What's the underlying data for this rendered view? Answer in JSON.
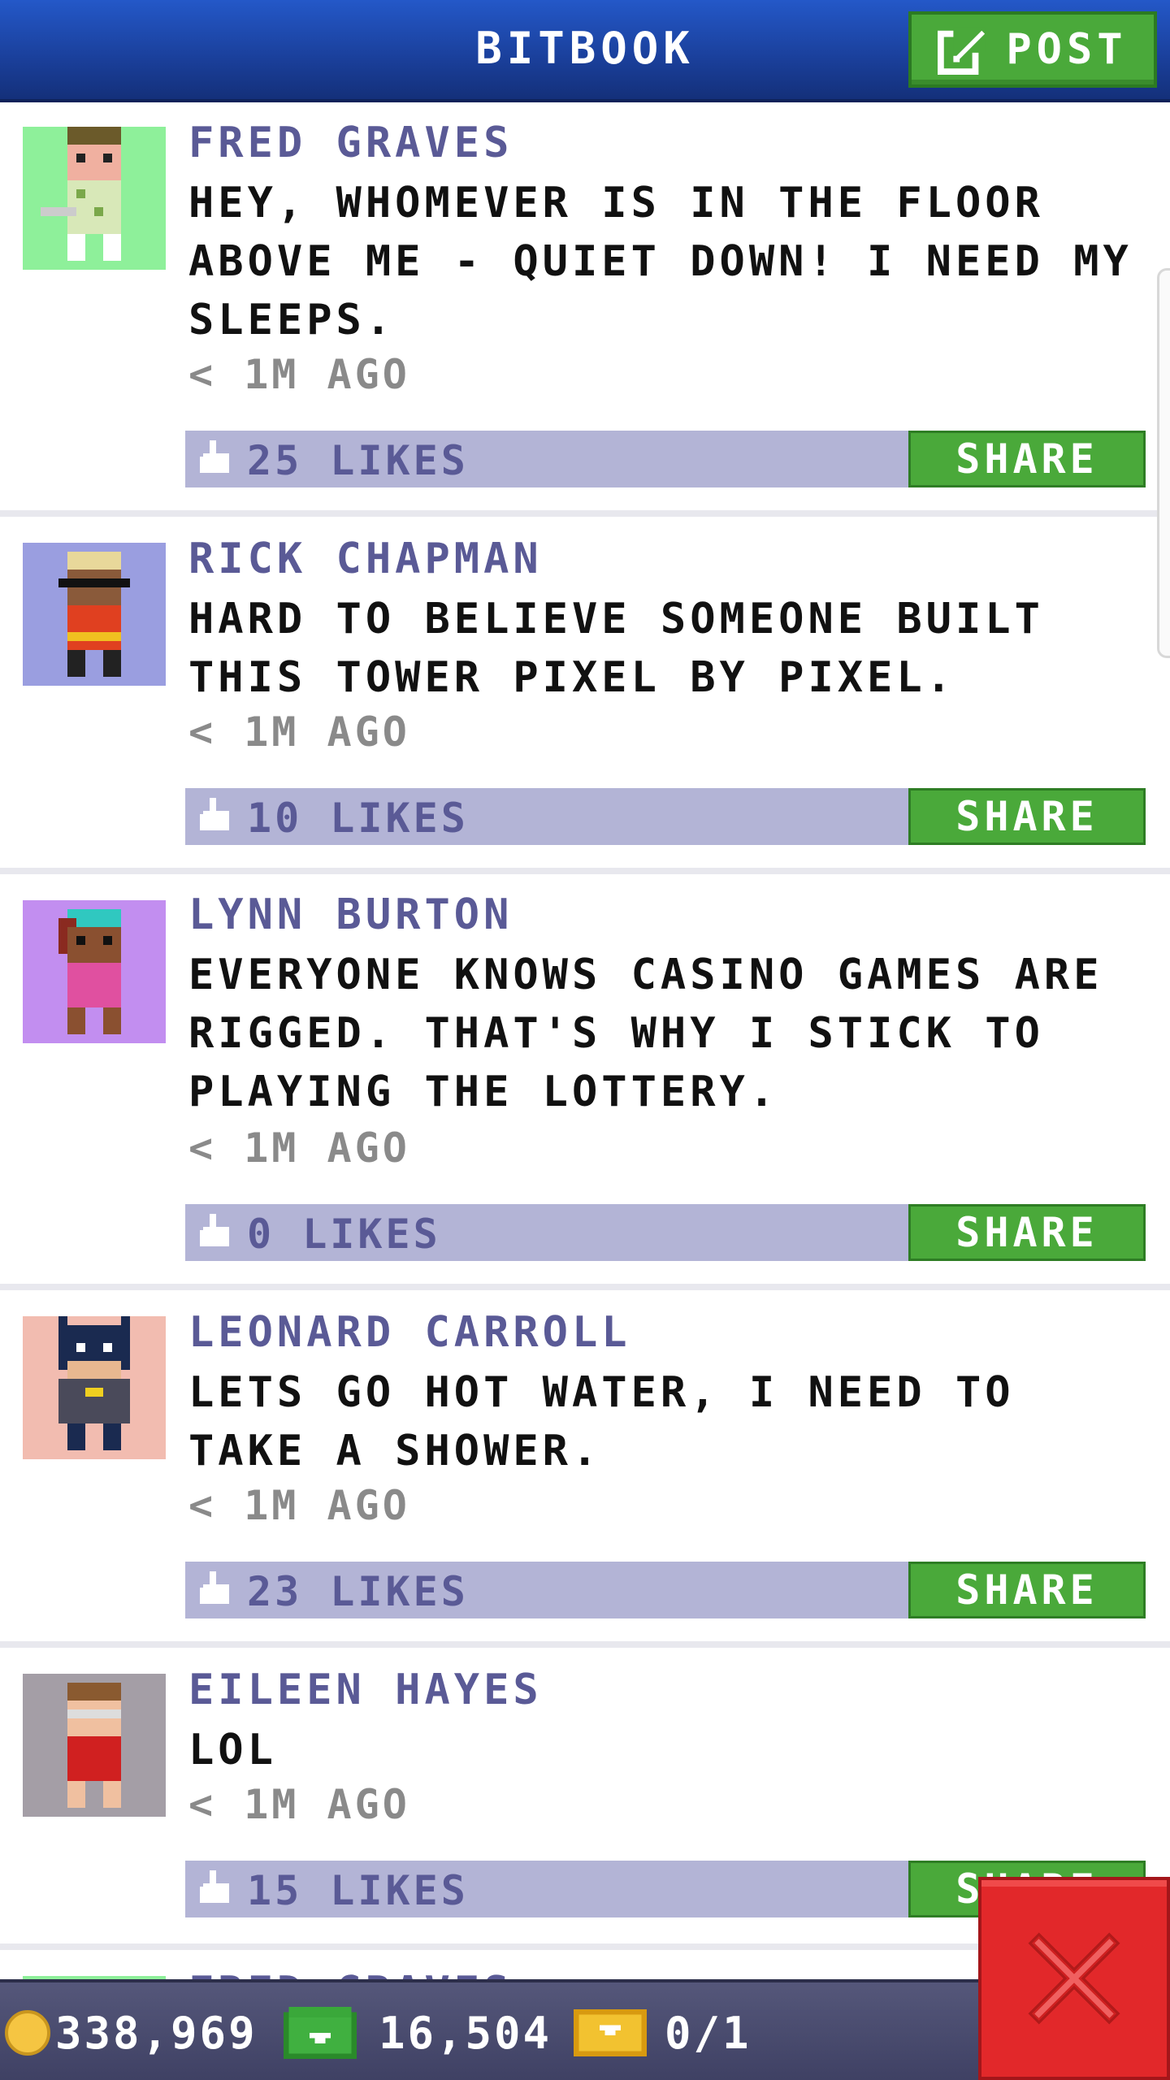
{
  "header": {
    "title": "BITBOOK",
    "post_label": "POST"
  },
  "posts": [
    {
      "author": "FRED GRAVES",
      "message": "HEY, WHOMEVER IS IN THE FLOOR ABOVE ME - QUIET DOWN! I NEED MY SLEEPS.",
      "time": "< 1M AGO",
      "likes": "25 LIKES",
      "share": "SHARE",
      "avatar_color": "#8ef09a"
    },
    {
      "author": "RICK CHAPMAN",
      "message": "HARD TO BELIEVE SOMEONE BUILT THIS TOWER PIXEL BY PIXEL.",
      "time": "< 1M AGO",
      "likes": "10 LIKES",
      "share": "SHARE",
      "avatar_color": "#9a9ee0"
    },
    {
      "author": "LYNN BURTON",
      "message": "EVERYONE KNOWS CASINO GAMES ARE RIGGED. THAT'S WHY I STICK TO PLAYING THE LOTTERY.",
      "time": "< 1M AGO",
      "likes": "0 LIKES",
      "share": "SHARE",
      "avatar_color": "#c28ef0"
    },
    {
      "author": "LEONARD CARROLL",
      "message": "LETS GO HOT WATER, I NEED TO TAKE A SHOWER.",
      "time": "< 1M AGO",
      "likes": "23 LIKES",
      "share": "SHARE",
      "avatar_color": "#f2bcb0"
    },
    {
      "author": "EILEEN HAYES",
      "message": "LOL",
      "time": "< 1M AGO",
      "likes": "15 LIKES",
      "share": "SHARE",
      "avatar_color": "#a49ea6"
    },
    {
      "author": "FRED GRAVES",
      "message": "",
      "time": "",
      "likes": "",
      "share": "",
      "avatar_color": "#8ef09a"
    }
  ],
  "status": {
    "coins": "338,969",
    "bux": "16,504",
    "tickets": "0/1"
  },
  "colors": {
    "header_blue": "#1a3f9a",
    "share_green": "#4aa93a",
    "likes_bar": "#b3b4d6",
    "author_purple": "#5a5a96",
    "close_red": "#e2282a"
  },
  "icons": {
    "post": "edit-icon",
    "like": "thumbs-up-icon",
    "coin": "coin-icon",
    "bux": "bux-icon",
    "ticket": "ticket-icon",
    "close": "close-icon"
  }
}
